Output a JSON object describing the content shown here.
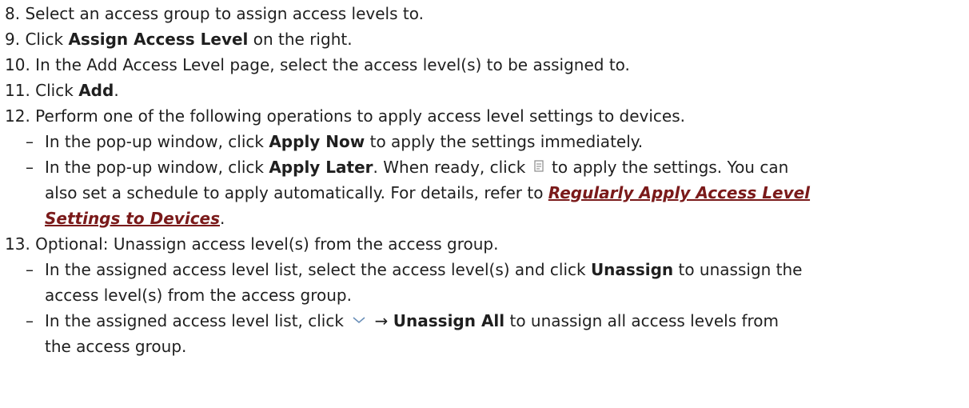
{
  "steps": {
    "s8": {
      "text": "8. Select an access group to assign access levels to."
    },
    "s9": {
      "prefix": "9. Click ",
      "bold": "Assign Access Level",
      "suffix": " on the right."
    },
    "s10": {
      "text": "10. In the Add Access Level page, select the access level(s) to be assigned to."
    },
    "s11": {
      "prefix": "11. Click ",
      "bold": "Add",
      "suffix": "."
    },
    "s12": {
      "text": "12. Perform one of the following operations to apply access level settings to devices.",
      "b1": {
        "dash": "–",
        "prefix": "In the pop-up window, click ",
        "bold": "Apply Now",
        "suffix": " to apply the settings immediately."
      },
      "b2": {
        "dash": "–",
        "prefix": "In the pop-up window, click ",
        "bold": "Apply Later",
        "mid": ". When ready, click ",
        "icon": "apply-settings-icon",
        "after_icon": " to apply the settings. You can",
        "line2": "also set a schedule to apply automatically. For details, refer to ",
        "link_part1": "Regularly Apply Access Level ",
        "link_part2": "Settings to Devices",
        "end": "."
      }
    },
    "s13": {
      "text": "13. Optional: Unassign access level(s) from the access group.",
      "b1": {
        "dash": "–",
        "prefix": "In the assigned access level list, select the access level(s) and click ",
        "bold": "Unassign",
        "suffix": " to unassign the",
        "line2": "access level(s) from the access group."
      },
      "b2": {
        "dash": "–",
        "prefix": "In the assigned access level list, click ",
        "icon": "chevron-down-icon",
        "arrow": " → ",
        "bold": "Unassign All",
        "suffix": " to unassign all access levels from",
        "line2": "the access group."
      }
    }
  },
  "colors": {
    "text": "#1f1f1f",
    "link": "#7a1a1a"
  }
}
